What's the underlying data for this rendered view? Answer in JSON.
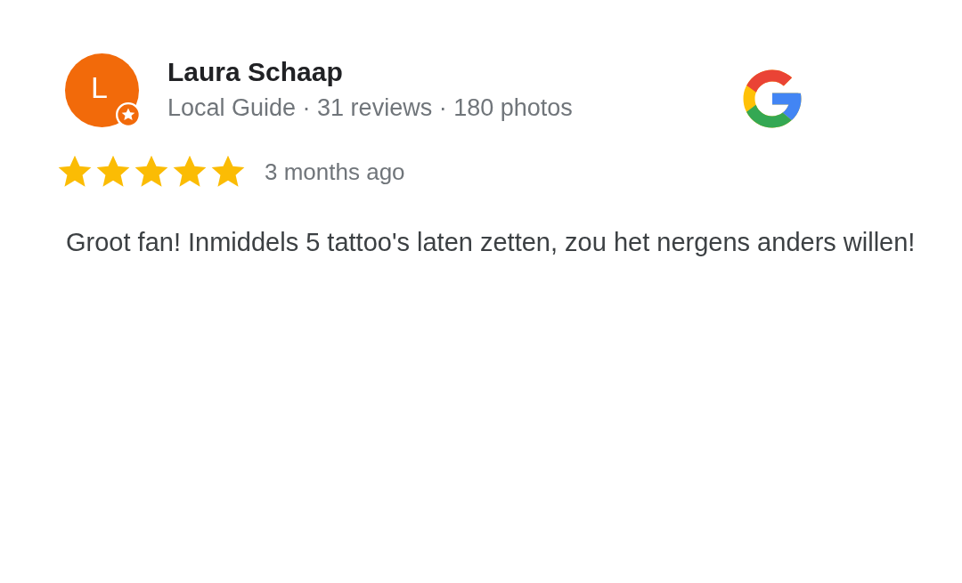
{
  "review": {
    "avatar_letter": "L",
    "local_guide": true,
    "author": "Laura Schaap",
    "meta": "Local Guide · 31 reviews · 180 photos",
    "stars": 5,
    "time": "3 months ago",
    "text": "Groot fan! Inmiddels 5 tattoo's laten zetten, zou het nergens anders willen!"
  }
}
